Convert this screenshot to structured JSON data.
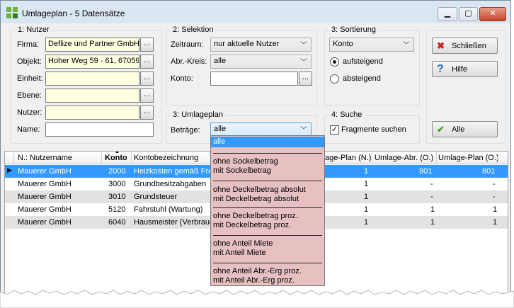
{
  "window": {
    "title": "Umlageplan - 5 Datensätze"
  },
  "nutzer": {
    "group_label": "1: Nutzer",
    "firma_label": "Firma:",
    "firma_value": "Deflize und Partner GmbH",
    "objekt_label": "Objekt:",
    "objekt_value": "Hoher Weg 59 - 61, 67059",
    "einheit_label": "Einheit:",
    "ebene_label": "Ebene:",
    "nutzer_label": "Nutzer:",
    "name_label": "Name:",
    "dots": "..."
  },
  "selektion": {
    "group_label": "2: Selektion",
    "zeitraum_label": "Zeitraum:",
    "zeitraum_value": "nur aktuelle Nutzer",
    "abrkreis_label": "Abr.-Kreis:",
    "abrkreis_value": "alle",
    "konto_label": "Konto:"
  },
  "umlageplan": {
    "group_label": "3: Umlageplan",
    "betraege_label": "Beträge:",
    "betraege_value": "alle"
  },
  "sortierung": {
    "group_label": "3: Sortierung",
    "value": "Konto",
    "asc_label": "aufsteigend",
    "desc_label": "absteigend"
  },
  "suche": {
    "group_label": "4: Suche",
    "fragmente_label": "Fragmente suchen"
  },
  "buttons": {
    "schliessen": "Schließen",
    "hilfe": "Hilfe",
    "alle": "Alle"
  },
  "dropdown": {
    "items": [
      "alle",
      "ohne Sockelbetrag",
      "mit Sockelbetrag",
      "ohne Deckelbetrag absolut",
      "mit Deckelbetrag absolut",
      "ohne Deckelbetrag proz.",
      "mit Deckelbetrag proz.",
      "ohne Anteil Miete",
      "mit Anteil Miete",
      "ohne Anteil Abr.-Erg proz.",
      "mit Anteil Abr.-Erg proz."
    ]
  },
  "table": {
    "columns": [
      "N.: Nutzername",
      "Konto",
      "Kontobezeichnung",
      "age-Plan (N.)",
      "Umlage-Abr. (O.)",
      "Umlage-Plan (O.)"
    ],
    "rows": [
      {
        "name": "Mauerer GmbH",
        "konto": "2000",
        "bez": "Heizkosten gemäß Frem",
        "plan_n": "1",
        "abr_o": "801",
        "plan_o": "801"
      },
      {
        "name": "Mauerer GmbH",
        "konto": "3000",
        "bez": "Grundbesitzabgaben",
        "plan_n": "1",
        "abr_o": "-",
        "plan_o": "-"
      },
      {
        "name": "Mauerer GmbH",
        "konto": "3010",
        "bez": "Grundsteuer",
        "plan_n": "1",
        "abr_o": "-",
        "plan_o": "-"
      },
      {
        "name": "Mauerer GmbH",
        "konto": "5120",
        "bez": "Fahrstuhl (Wartung)",
        "plan_n": "1",
        "abr_o": "1",
        "plan_o": "1"
      },
      {
        "name": "Mauerer GmbH",
        "konto": "6040",
        "bez": "Hausmeister (Verbrauch",
        "plan_n": "1",
        "abr_o": "1",
        "plan_o": "1"
      }
    ]
  }
}
